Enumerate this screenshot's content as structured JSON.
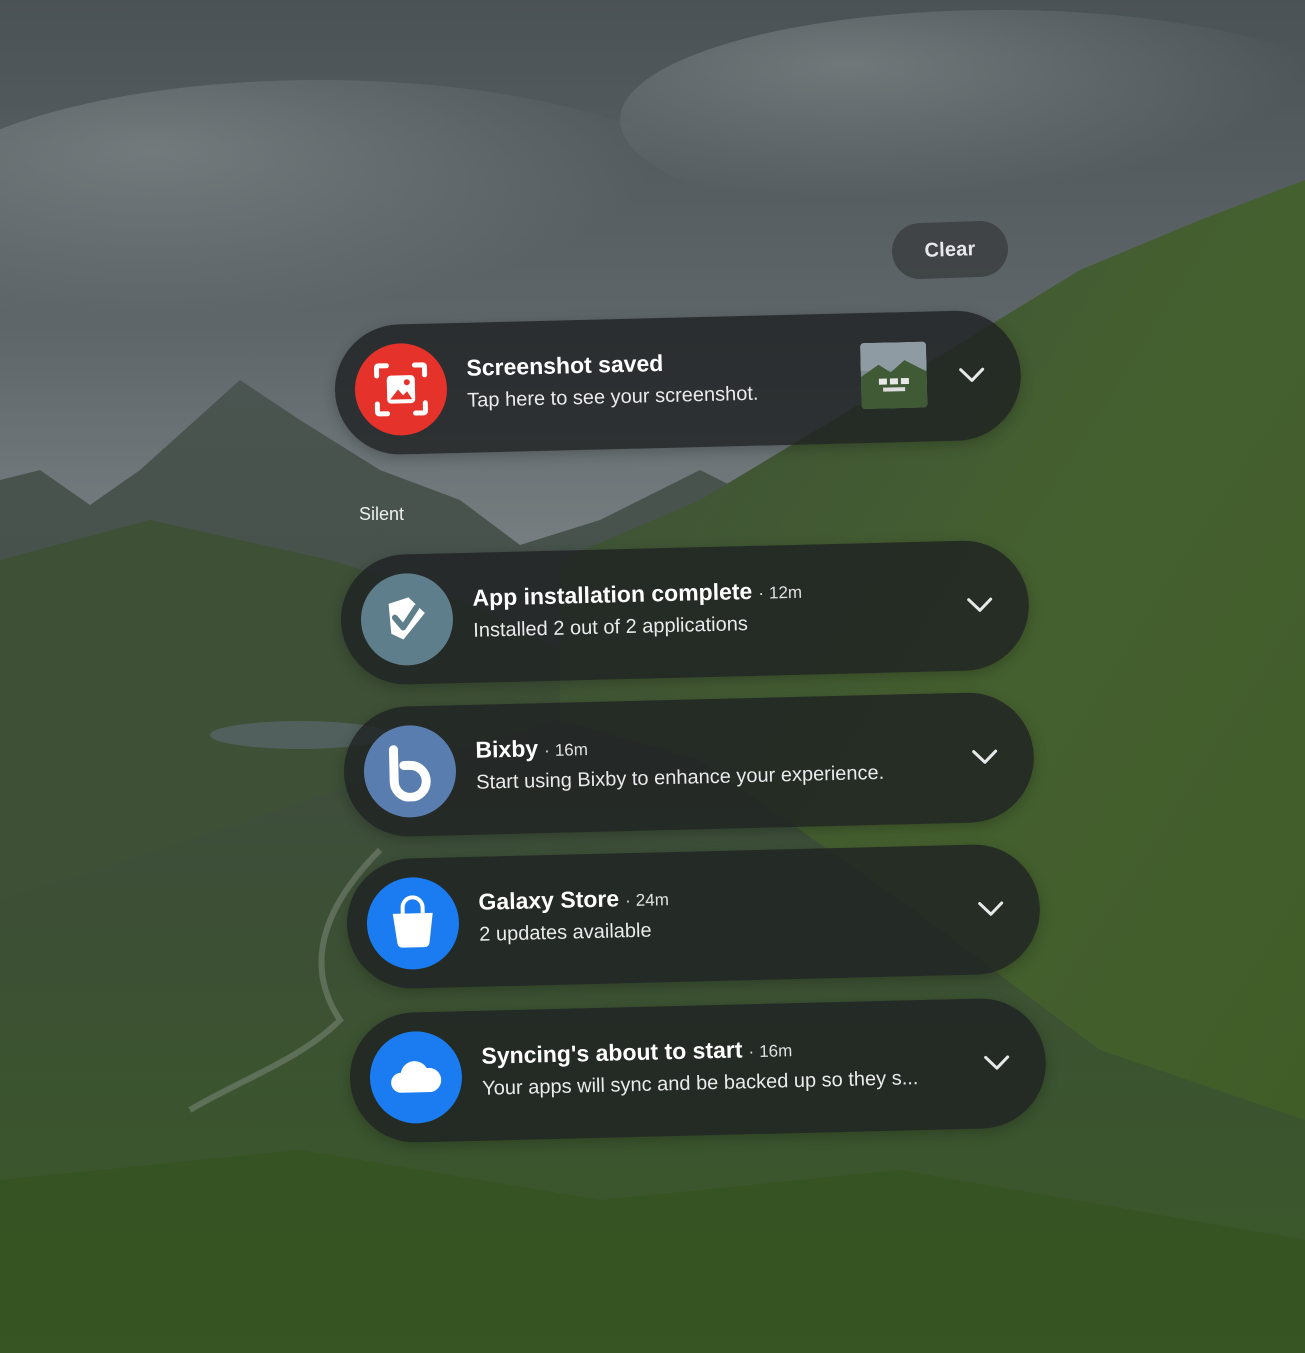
{
  "clear_button": {
    "label": "Clear"
  },
  "section": {
    "silent_label": "Silent"
  },
  "notifications": [
    {
      "app_icon": "screenshot-icon",
      "icon_color": "#e5322b",
      "title": "Screenshot saved",
      "time": "",
      "body": "Tap here to see your screenshot.",
      "has_thumbnail": true
    },
    {
      "app_icon": "package-installer-icon",
      "icon_color": "#5f7e8c",
      "title": "App installation complete",
      "time": "12m",
      "body": "Installed 2 out of 2 applications"
    },
    {
      "app_icon": "bixby-icon",
      "icon_color": "#5a7db0",
      "title": "Bixby",
      "time": "16m",
      "body": "Start using Bixby to enhance your experience."
    },
    {
      "app_icon": "galaxy-store-icon",
      "icon_color": "#1a7cf0",
      "title": "Galaxy Store",
      "time": "24m",
      "body": "2 updates available"
    },
    {
      "app_icon": "cloud-sync-icon",
      "icon_color": "#1a7cf0",
      "title": "Syncing's about to start",
      "time": "16m",
      "body": "Your apps will sync and be backed up so they s..."
    }
  ]
}
